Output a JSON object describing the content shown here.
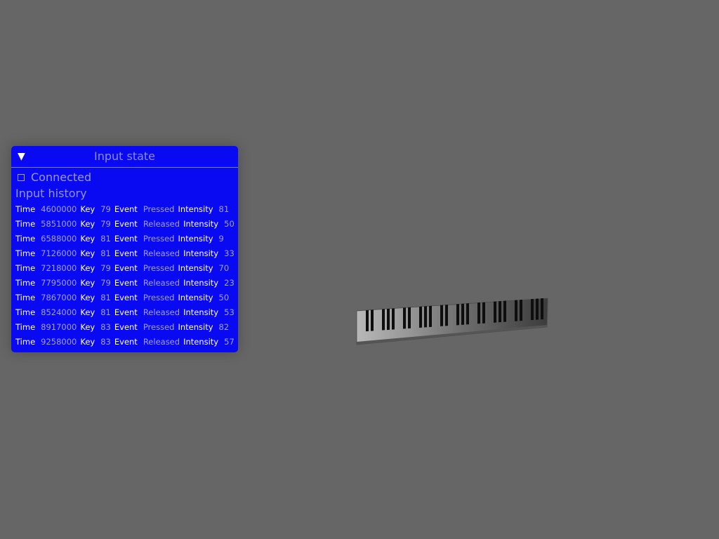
{
  "panel": {
    "title": "Input state",
    "toggle_glyph": "▼",
    "connected_label": "Connected",
    "connected_checked": false,
    "history_title": "Input history",
    "labels": {
      "time": "Time",
      "key": "Key",
      "event": "Event",
      "intensity": "Intensity"
    },
    "history": [
      {
        "time": "4600000",
        "key": "79",
        "event": "Pressed",
        "intensity": "81"
      },
      {
        "time": "5851000",
        "key": "79",
        "event": "Released",
        "intensity": "50"
      },
      {
        "time": "6588000",
        "key": "81",
        "event": "Pressed",
        "intensity": "9"
      },
      {
        "time": "7126000",
        "key": "81",
        "event": "Released",
        "intensity": "33"
      },
      {
        "time": "7218000",
        "key": "79",
        "event": "Pressed",
        "intensity": "70"
      },
      {
        "time": "7795000",
        "key": "79",
        "event": "Released",
        "intensity": "23"
      },
      {
        "time": "7867000",
        "key": "81",
        "event": "Pressed",
        "intensity": "50"
      },
      {
        "time": "8524000",
        "key": "81",
        "event": "Released",
        "intensity": "53"
      },
      {
        "time": "8917000",
        "key": "83",
        "event": "Pressed",
        "intensity": "82"
      },
      {
        "time": "9258000",
        "key": "83",
        "event": "Released",
        "intensity": "57"
      }
    ]
  },
  "colors": {
    "background": "#666666",
    "panel": "#0a0af2",
    "label": "#ffffff",
    "value": "#a1a1ef"
  },
  "scene": {
    "object": "piano-keyboard-icon"
  }
}
